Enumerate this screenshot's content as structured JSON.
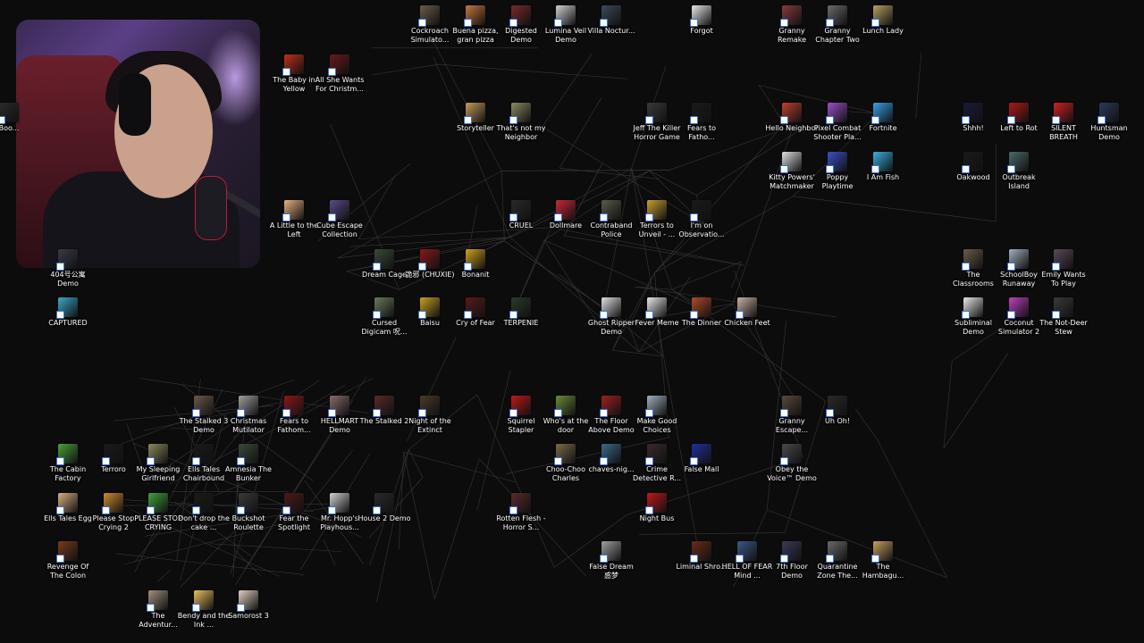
{
  "desktop": {
    "icons": [
      {
        "label": "Cockroach Simulato...",
        "color": "#6d5b4a"
      },
      {
        "label": "Buena pizza, gran pizza",
        "color": "#c4763a"
      },
      {
        "label": "Digested Demo",
        "color": "#7a2a2a"
      },
      {
        "label": "Lumina Veil Demo",
        "color": "#d0d0d0"
      },
      {
        "label": "Villa Noctur...",
        "color": "#3a4a5a"
      },
      {
        "label": "Forgot",
        "color": "#e8e8e8"
      },
      {
        "label": "Granny Remake",
        "color": "#8a3a3a"
      },
      {
        "label": "Granny Chapter Two",
        "color": "#6a6a6a"
      },
      {
        "label": "Lunch Lady",
        "color": "#b8a060"
      },
      {
        "label": "The Baby in Yellow",
        "color": "#c03018"
      },
      {
        "label": "All She Wants For Christm...",
        "color": "#6a1a1a"
      },
      {
        "label": "Storyteller",
        "color": "#c89a5a"
      },
      {
        "label": "That's not my Neighbor",
        "color": "#8a8a60"
      },
      {
        "label": "Jeff The Killer Horror Game",
        "color": "#3a3a3a"
      },
      {
        "label": "Fears to Fatho...",
        "color": "#1a1a1a"
      },
      {
        "label": "Hello Neighbor",
        "color": "#c04030"
      },
      {
        "label": "Pixel Combat Shooter Pla...",
        "color": "#9a50c8"
      },
      {
        "label": "Fortnite",
        "color": "#3aa0e8"
      },
      {
        "label": "Shhh!",
        "color": "#1a1a3a"
      },
      {
        "label": "Left to Rot",
        "color": "#b01818"
      },
      {
        "label": "SILENT BREATH",
        "color": "#d02020"
      },
      {
        "label": "Huntsman Demo",
        "color": "#2a3a5a"
      },
      {
        "label": "Kitty Powers' Matchmaker",
        "color": "#e0e0e0"
      },
      {
        "label": "Poppy Playtime",
        "color": "#3a50c8"
      },
      {
        "label": "I Am Fish",
        "color": "#3ab0e0"
      },
      {
        "label": "Oakwood",
        "color": "#1a1a1a"
      },
      {
        "label": "Outbreak Island",
        "color": "#4a6a6a"
      },
      {
        "label": "A Little to the Left",
        "color": "#e8b080"
      },
      {
        "label": "Cube Escape Collection",
        "color": "#5a4a8a"
      },
      {
        "label": "CRUEL",
        "color": "#2a2a2a"
      },
      {
        "label": "Dollmare",
        "color": "#c82838"
      },
      {
        "label": "Contraband Police",
        "color": "#5a5a4a"
      },
      {
        "label": "Terrors to Unveil - ...",
        "color": "#c8a030"
      },
      {
        "label": "I'm on Observatio...",
        "color": "#1a1a1a"
      },
      {
        "label": "Dream Cage",
        "color": "#3a4a3a"
      },
      {
        "label": "詭邪 (CHUXIE)",
        "color": "#8a1a1a"
      },
      {
        "label": "Bonanit",
        "color": "#d0a020"
      },
      {
        "label": "The Classrooms",
        "color": "#6a5a4a"
      },
      {
        "label": "SchoolBoy Runaway",
        "color": "#a0b0c0"
      },
      {
        "label": "Emily Wants To Play",
        "color": "#5a4a5a"
      },
      {
        "label": "404号公寓 Demo",
        "color": "#3a3a4a"
      },
      {
        "label": "CAPTURED",
        "color": "#3aa8c8"
      },
      {
        "label": "Cursed Digicam 呪...",
        "color": "#6a7a5a"
      },
      {
        "label": "Baisu",
        "color": "#c8a020"
      },
      {
        "label": "Cry of Fear",
        "color": "#5a1a1a"
      },
      {
        "label": "TERPENIE",
        "color": "#2a3a2a"
      },
      {
        "label": "Ghost Ripper Demo",
        "color": "#e0e0e0"
      },
      {
        "label": "Fever Meme",
        "color": "#e8e8e8"
      },
      {
        "label": "The Dinner",
        "color": "#b04a2a"
      },
      {
        "label": "Chicken Feet",
        "color": "#c8b0a0"
      },
      {
        "label": "Subliminal Demo",
        "color": "#e8e8e8"
      },
      {
        "label": "Coconut Simulator 2",
        "color": "#c040c0"
      },
      {
        "label": "The Not-Deer Stew",
        "color": "#3a3a3a"
      },
      {
        "label": "The Stalked 3 Demo",
        "color": "#6a5a4a"
      },
      {
        "label": "Christmas Mutilator",
        "color": "#a0a0a0"
      },
      {
        "label": "Fears to Fathom...",
        "color": "#8a1818"
      },
      {
        "label": "HELLMART Demo",
        "color": "#8a6a6a"
      },
      {
        "label": "The Stalked 2",
        "color": "#5a2a2a"
      },
      {
        "label": "Night of the Extinct",
        "color": "#4a3a2a"
      },
      {
        "label": "Squirrel Stapler",
        "color": "#c01818"
      },
      {
        "label": "Who's at the door",
        "color": "#6a8a3a"
      },
      {
        "label": "The Floor Above Demo",
        "color": "#a02020"
      },
      {
        "label": "Make Good Choices",
        "color": "#a0b0c0"
      },
      {
        "label": "Granny Escape...",
        "color": "#5a4a3a"
      },
      {
        "label": "Uh Oh!",
        "color": "#2a2a2a"
      },
      {
        "label": "The Cabin Factory",
        "color": "#4aa03a"
      },
      {
        "label": "Terroro",
        "color": "#1a1a1a"
      },
      {
        "label": "My Sleeping Girlfriend",
        "color": "#8a8a5a"
      },
      {
        "label": "Ells Tales Chairbound",
        "color": "#1a1a1a"
      },
      {
        "label": "Amnesia The Bunker",
        "color": "#3a4a3a"
      },
      {
        "label": "Choo-Choo Charles",
        "color": "#7a6a4a"
      },
      {
        "label": "chaves-nig...",
        "color": "#3a6a8a"
      },
      {
        "label": "Crime Detective R...",
        "color": "#3a2a2a"
      },
      {
        "label": "False Mall",
        "color": "#2030a0"
      },
      {
        "label": "Obey the Voice™ Demo",
        "color": "#4a4a4a"
      },
      {
        "label": "Ells Tales Egg",
        "color": "#d8b080"
      },
      {
        "label": "Please Stop Crying 2",
        "color": "#d08a30"
      },
      {
        "label": "PLEASE STOP CRYING",
        "color": "#40a040"
      },
      {
        "label": "Don't drop the cake ...",
        "color": "#1a1a1a"
      },
      {
        "label": "Buckshot Roulette",
        "color": "#3a3a3a"
      },
      {
        "label": "Fear the Spotlight",
        "color": "#4a1a1a"
      },
      {
        "label": "Mr. Hopp's Playhous...",
        "color": "#d0d0d0"
      },
      {
        "label": "House 2 Demo",
        "color": "#2a2a2a"
      },
      {
        "label": "Rotten Flesh - Horror S...",
        "color": "#5a2a2a"
      },
      {
        "label": "Night Bus",
        "color": "#c01818"
      },
      {
        "label": "Revenge Of The Colon",
        "color": "#7a3a1a"
      },
      {
        "label": "False Dream 惑梦",
        "color": "#a0a0a0"
      },
      {
        "label": "Liminal Shro...",
        "color": "#6a2a1a"
      },
      {
        "label": "HELL OF FEAR Mind ...",
        "color": "#3a5a8a"
      },
      {
        "label": "7th Floor Demo",
        "color": "#3a3a5a"
      },
      {
        "label": "Quarantine Zone The...",
        "color": "#6a6a6a"
      },
      {
        "label": "The Hambagu...",
        "color": "#c8a060"
      },
      {
        "label": "The Adventur...",
        "color": "#a09080"
      },
      {
        "label": "Bendy and the Ink ...",
        "color": "#e8c060"
      },
      {
        "label": "Samorost 3",
        "color": "#e0d0c0"
      },
      {
        "label": "Boo...",
        "color": "#2a2a2a"
      }
    ]
  },
  "webcam": {
    "accent": "#7a50c0"
  }
}
